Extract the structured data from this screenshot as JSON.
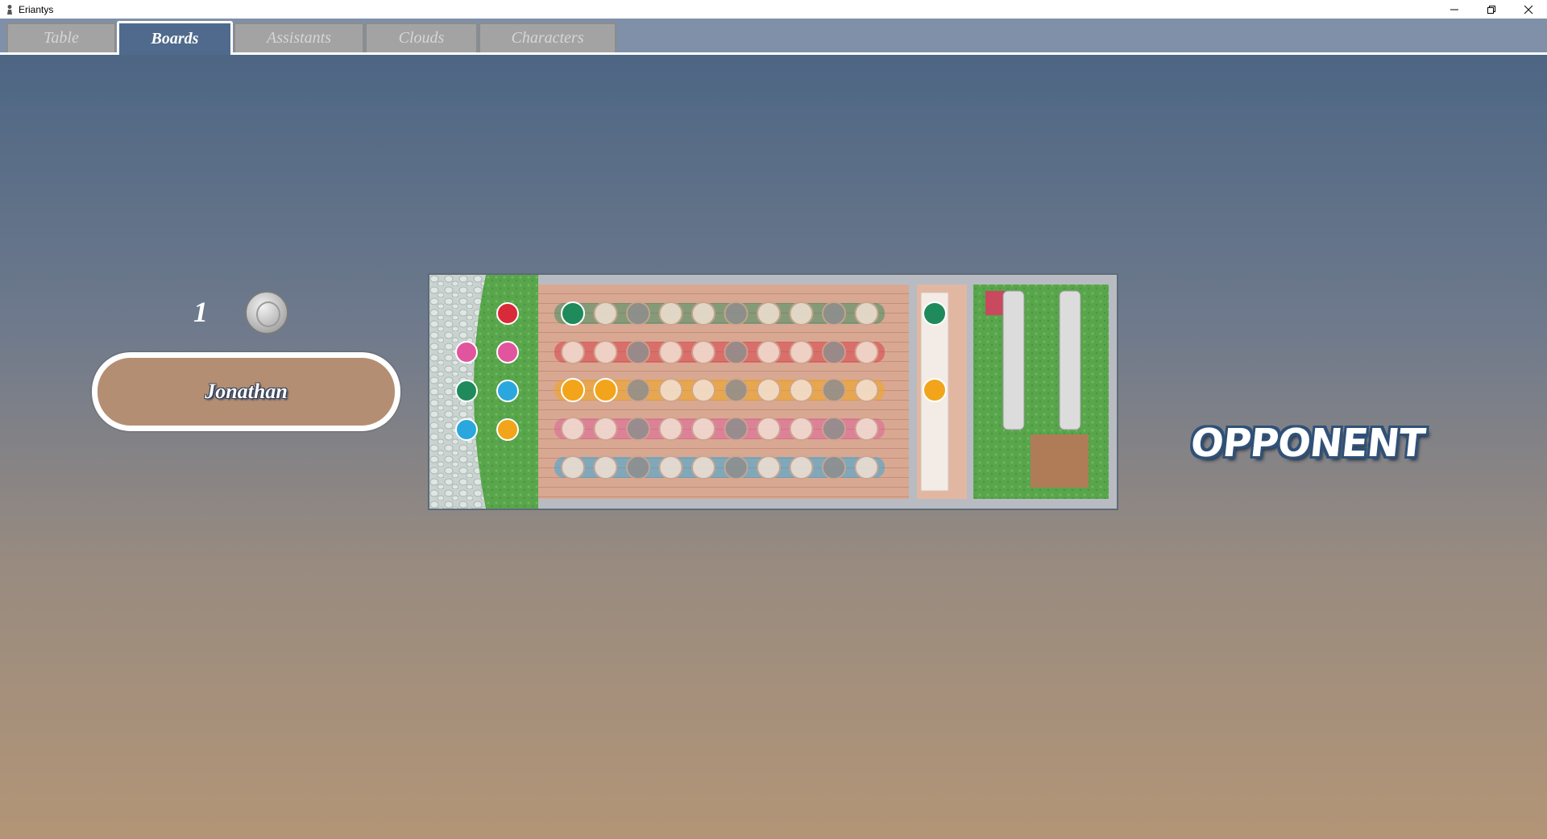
{
  "window": {
    "title": "Eriantys",
    "icon": "chess-pawn-icon",
    "controls": [
      "minimize-icon",
      "restore-icon",
      "close-icon"
    ]
  },
  "tabs": [
    {
      "label": "Table",
      "active": false
    },
    {
      "label": "Boards",
      "active": true
    },
    {
      "label": "Assistants",
      "active": false
    },
    {
      "label": "Clouds",
      "active": false
    },
    {
      "label": "Characters",
      "active": false
    }
  ],
  "player": {
    "coins": "1",
    "name": "Jonathan"
  },
  "opponent_label": "OPPONENT",
  "colors": {
    "tabbar": "#7f90a8",
    "active_tab": "#4f6a8c",
    "name_plate": "#b48e73",
    "student_colors": [
      "#1f8a5b",
      "#d92a3a",
      "#f2a51a",
      "#e0559e",
      "#2aa7df"
    ]
  },
  "board": {
    "entrance_students": [
      "red",
      "pink",
      "pink",
      "green",
      "blue",
      "blue",
      "yellow"
    ],
    "dining_rows": [
      {
        "color": "green",
        "students": 1
      },
      {
        "color": "red",
        "students": 0
      },
      {
        "color": "yellow",
        "students": 2
      },
      {
        "color": "pink",
        "students": 0
      },
      {
        "color": "blue",
        "students": 0
      }
    ],
    "professors": [
      "green",
      "none",
      "yellow",
      "none",
      "none"
    ],
    "towers": 0
  }
}
